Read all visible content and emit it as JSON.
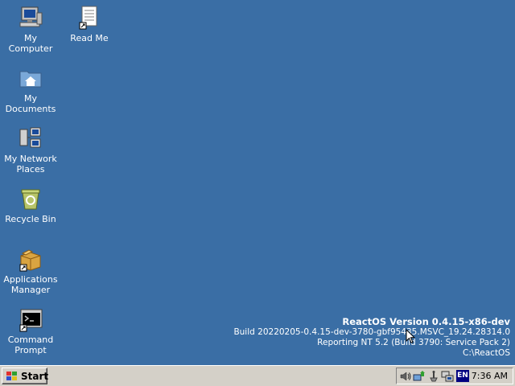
{
  "desktop": {
    "background_color": "#3a6ea5",
    "icons": [
      {
        "label": "My Computer",
        "icon": "computer-icon"
      },
      {
        "label": "Read Me",
        "icon": "document-icon"
      },
      {
        "label": "My Documents",
        "icon": "folder-home-icon"
      },
      {
        "label": "My Network Places",
        "icon": "network-icon"
      },
      {
        "label": "Recycle Bin",
        "icon": "recycle-bin-icon"
      },
      {
        "label": "Applications Manager",
        "icon": "package-box-icon"
      },
      {
        "label": "Command Prompt",
        "icon": "console-icon"
      }
    ]
  },
  "version_info": {
    "title": "ReactOS Version 0.4.15-x86-dev",
    "build": "Build 20220205-0.4.15-dev-3780-gbf95435.MSVC_19.24.28314.0",
    "reporting": "Reporting NT 5.2 (Build 3790: Service Pack 2)",
    "path": "C:\\ReactOS"
  },
  "taskbar": {
    "start_label": "Start",
    "tray": {
      "icons": [
        "volume-icon",
        "network-status-icon",
        "safely-remove-icon",
        "display-icon"
      ],
      "language": "EN",
      "clock": "7:36 AM"
    }
  }
}
